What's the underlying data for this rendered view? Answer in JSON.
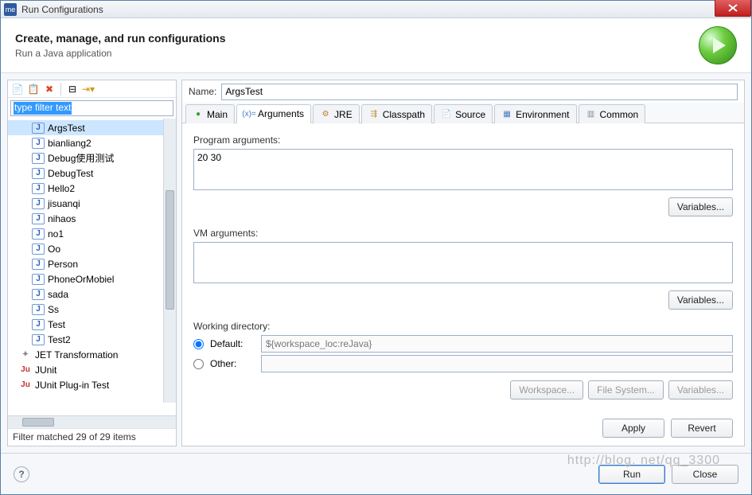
{
  "titlebar": {
    "title": "Run Configurations"
  },
  "header": {
    "title": "Create, manage, and run configurations",
    "subtitle": "Run a Java application"
  },
  "filter": {
    "placeholder": "type filter text"
  },
  "tree": {
    "items": [
      {
        "label": "ArgsTest",
        "kind": "java",
        "selected": true
      },
      {
        "label": "bianliang2",
        "kind": "java"
      },
      {
        "label": "Debug使用测试",
        "kind": "java"
      },
      {
        "label": "DebugTest",
        "kind": "java"
      },
      {
        "label": "Hello2",
        "kind": "java"
      },
      {
        "label": "jisuanqi",
        "kind": "java"
      },
      {
        "label": "nihaos",
        "kind": "java"
      },
      {
        "label": "no1",
        "kind": "java"
      },
      {
        "label": "Oo",
        "kind": "java"
      },
      {
        "label": "Person",
        "kind": "java"
      },
      {
        "label": "PhoneOrMobiel",
        "kind": "java"
      },
      {
        "label": "sada",
        "kind": "java"
      },
      {
        "label": "Ss",
        "kind": "java"
      },
      {
        "label": "Test",
        "kind": "java"
      },
      {
        "label": "Test2",
        "kind": "java"
      }
    ],
    "categories": [
      {
        "label": "JET Transformation",
        "ic": "jet"
      },
      {
        "label": "JUnit",
        "ic": "ju"
      },
      {
        "label": "JUnit Plug-in Test",
        "ic": "ju"
      }
    ]
  },
  "status": "Filter matched 29 of 29 items",
  "name": {
    "label": "Name:",
    "value": "ArgsTest"
  },
  "tabs": [
    "Main",
    "Arguments",
    "JRE",
    "Classpath",
    "Source",
    "Environment",
    "Common"
  ],
  "active_tab": 1,
  "args": {
    "program_label": "Program arguments:",
    "program_value": "20 30",
    "vm_label": "VM arguments:",
    "vm_value": "",
    "variables_btn": "Variables..."
  },
  "wd": {
    "section": "Working directory:",
    "default_label": "Default:",
    "default_value": "${workspace_loc:reJava}",
    "other_label": "Other:",
    "workspace_btn": "Workspace...",
    "filesystem_btn": "File System...",
    "variables_btn": "Variables..."
  },
  "buttons": {
    "apply": "Apply",
    "revert": "Revert",
    "run": "Run",
    "close": "Close"
  },
  "watermark": "http://blog.        net/qq_3300    "
}
